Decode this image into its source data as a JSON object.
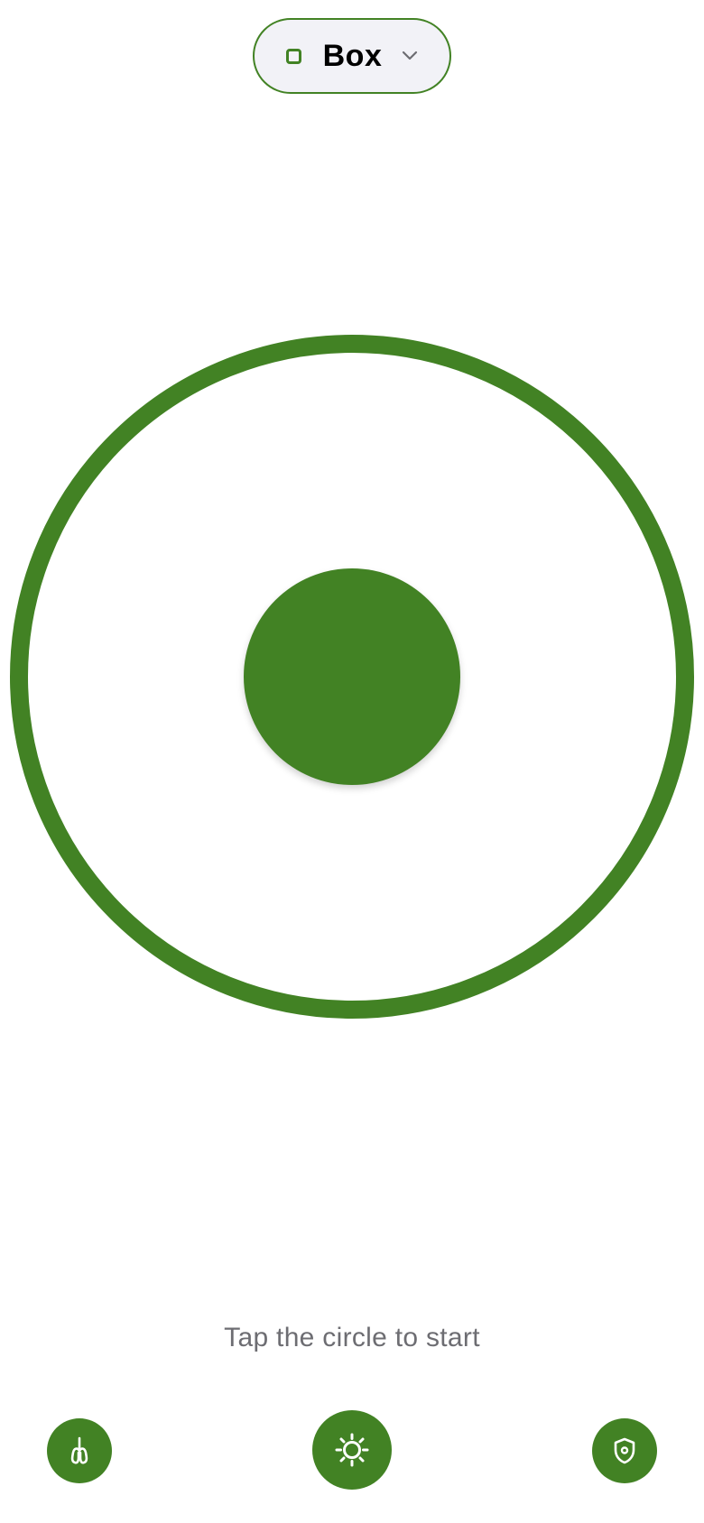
{
  "header": {
    "mode_label": "Box",
    "mode_icon": "square-icon",
    "dropdown_icon": "chevron-down-icon"
  },
  "main": {
    "hint": "Tap the circle to start"
  },
  "toolbar": {
    "left_icon": "lungs-icon",
    "center_icon": "sun-icon",
    "right_icon": "shield-icon"
  },
  "colors": {
    "accent": "#428224",
    "selector_bg": "#f2f2f7",
    "hint_text": "#6d6d72",
    "background": "#ffffff"
  }
}
